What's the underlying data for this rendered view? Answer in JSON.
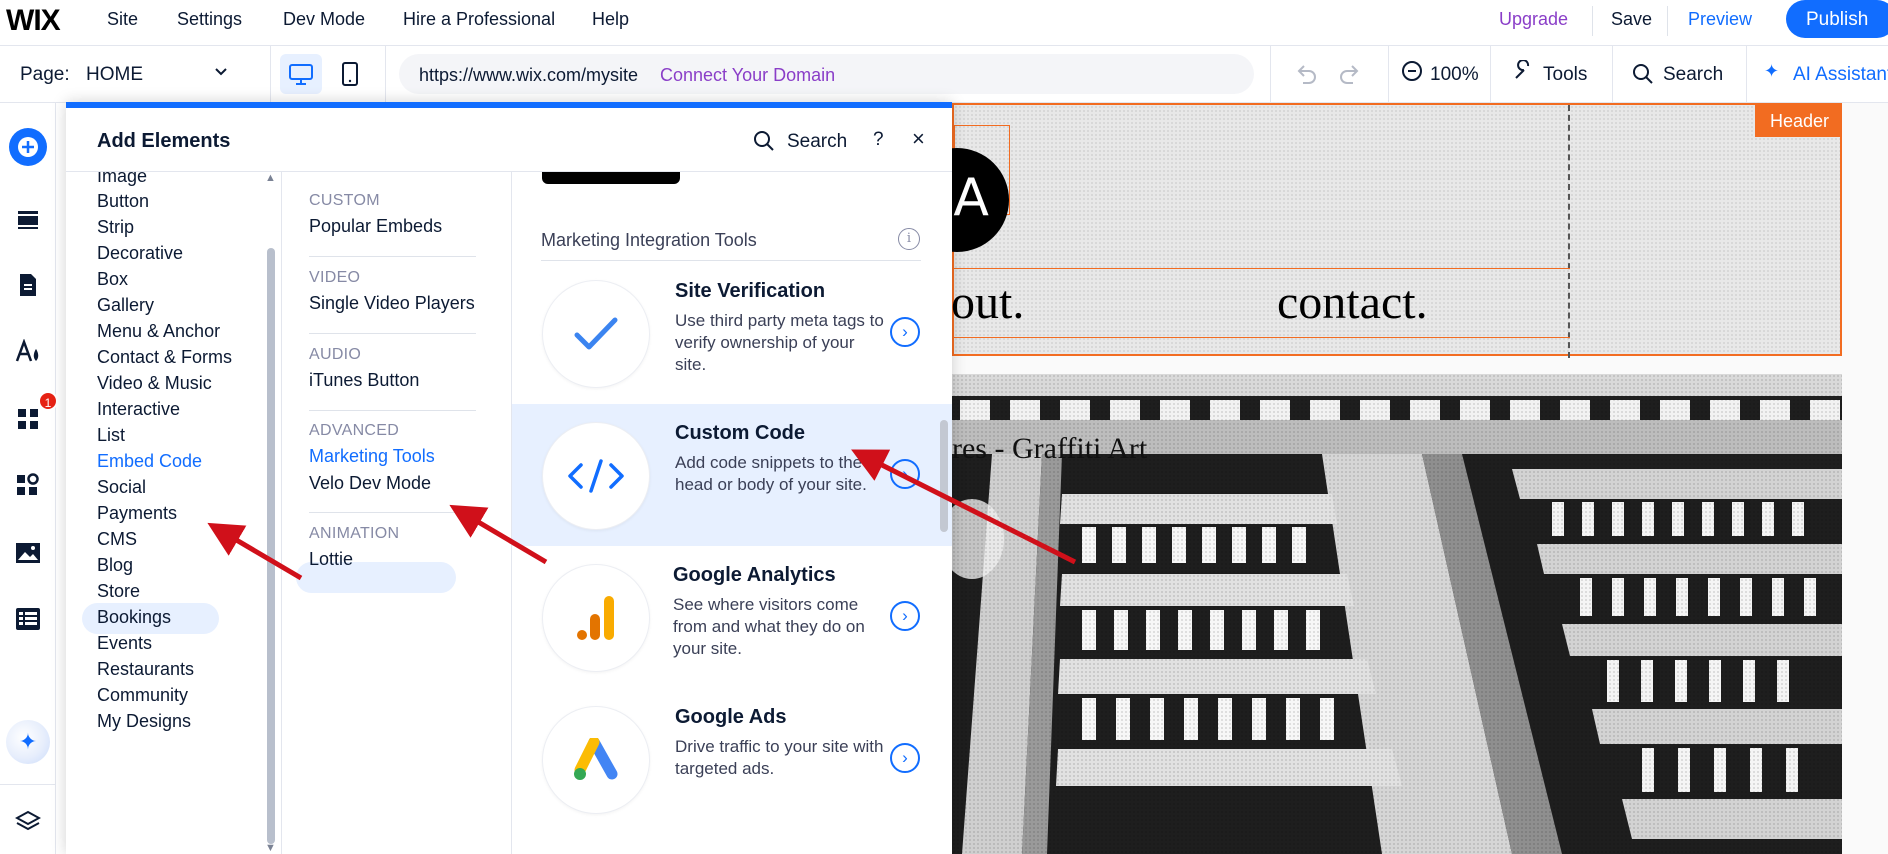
{
  "topbar": {
    "logo": "WIX",
    "menu": [
      "Site",
      "Settings",
      "Dev Mode",
      "Hire a Professional",
      "Help"
    ],
    "upgrade": "Upgrade",
    "save": "Save",
    "preview": "Preview",
    "publish": "Publish"
  },
  "secondbar": {
    "page_label": "Page:",
    "page_value": "HOME",
    "url": "https://www.wix.com/mysite",
    "connect_domain": "Connect Your Domain",
    "zoom": "100%",
    "tools": "Tools",
    "search": "Search",
    "ai_assistant": "AI Assistant"
  },
  "leftrail": {
    "icons": [
      "add-icon",
      "sections-icon",
      "pages-icon",
      "design-icon",
      "apps-icon",
      "business-apps-icon",
      "media-icon",
      "cms-icon",
      "ai-sparkle-icon",
      "layers-icon"
    ],
    "apps_badge": "1"
  },
  "panel": {
    "title": "Add Elements",
    "search": "Search",
    "help": "?",
    "close": "×",
    "categories": [
      "Image",
      "Button",
      "Strip",
      "Decorative",
      "Box",
      "Gallery",
      "Menu & Anchor",
      "Contact & Forms",
      "Video & Music",
      "Interactive",
      "List",
      "Embed Code",
      "Social",
      "Payments",
      "CMS",
      "Blog",
      "Store",
      "Bookings",
      "Events",
      "Restaurants",
      "Community",
      "My Designs"
    ],
    "active_category": "Embed Code",
    "subsections": [
      {
        "heading": "CUSTOM",
        "items": [
          "Popular Embeds"
        ]
      },
      {
        "heading": "VIDEO",
        "items": [
          "Single Video Players"
        ]
      },
      {
        "heading": "AUDIO",
        "items": [
          "iTunes Button"
        ]
      },
      {
        "heading": "ADVANCED",
        "items": [
          "Marketing Tools",
          "Velo Dev Mode"
        ]
      },
      {
        "heading": "ANIMATION",
        "items": [
          "Lottie"
        ]
      }
    ],
    "active_subsection": "Marketing Tools",
    "content": {
      "section_title": "Marketing Integration Tools",
      "info": "i",
      "cards": [
        {
          "title": "Site Verification",
          "desc": "Use third party meta tags to verify ownership of your site.",
          "icon": "checkmark-icon"
        },
        {
          "title": "Custom Code",
          "desc": "Add code snippets to the head or body of your site.",
          "icon": "code-icon"
        },
        {
          "title": "Google Analytics",
          "desc": "See where visitors come from and what they do on your site.",
          "icon": "analytics-icon"
        },
        {
          "title": "Google Ads",
          "desc": "Drive traffic to your site with targeted ads.",
          "icon": "google-ads-icon"
        }
      ]
    }
  },
  "canvas": {
    "header_tag": "Header",
    "logo_letter": "A",
    "nav_words": [
      "out.",
      "contact."
    ],
    "image_title": "res - Graffiti Art"
  },
  "colors": {
    "brand_blue": "#116dff",
    "upgrade_purple": "#8a3ec8",
    "selection_orange": "#f26c21",
    "annotation_red": "#d0101a"
  }
}
